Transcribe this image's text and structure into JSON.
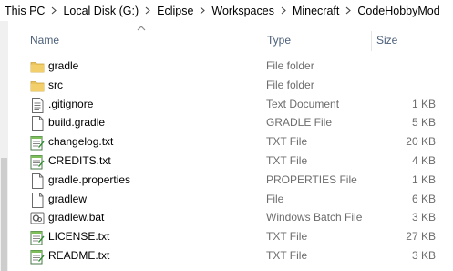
{
  "breadcrumb": [
    "This PC",
    "Local Disk (G:)",
    "Eclipse",
    "Workspaces",
    "Minecraft",
    "CodeHobbyMod"
  ],
  "columns": {
    "name": "Name",
    "type": "Type",
    "size": "Size"
  },
  "sort": {
    "column": "Name",
    "indicator": "chevron-up"
  },
  "files": [
    {
      "name": "gradle",
      "type": "File folder",
      "size": "",
      "icon": "folder-icon"
    },
    {
      "name": "src",
      "type": "File folder",
      "size": "",
      "icon": "folder-icon"
    },
    {
      "name": ".gitignore",
      "type": "Text Document",
      "size": "1 KB",
      "icon": "text-document-icon"
    },
    {
      "name": "build.gradle",
      "type": "GRADLE File",
      "size": "5 KB",
      "icon": "generic-file-icon"
    },
    {
      "name": "changelog.txt",
      "type": "TXT File",
      "size": "20 KB",
      "icon": "notepadpp-file-icon"
    },
    {
      "name": "CREDITS.txt",
      "type": "TXT File",
      "size": "4 KB",
      "icon": "notepadpp-file-icon"
    },
    {
      "name": "gradle.properties",
      "type": "PROPERTIES File",
      "size": "1 KB",
      "icon": "generic-file-icon"
    },
    {
      "name": "gradlew",
      "type": "File",
      "size": "6 KB",
      "icon": "generic-file-icon"
    },
    {
      "name": "gradlew.bat",
      "type": "Windows Batch File",
      "size": "3 KB",
      "icon": "batch-file-icon"
    },
    {
      "name": "LICENSE.txt",
      "type": "TXT File",
      "size": "27 KB",
      "icon": "notepadpp-file-icon"
    },
    {
      "name": "README.txt",
      "type": "TXT File",
      "size": "3 KB",
      "icon": "notepadpp-file-icon"
    }
  ],
  "colors": {
    "header_text": "#4c607a",
    "secondary_text": "#6d6d6d",
    "folder": "#e8c15a",
    "notepad_green": "#2f8f2f"
  }
}
